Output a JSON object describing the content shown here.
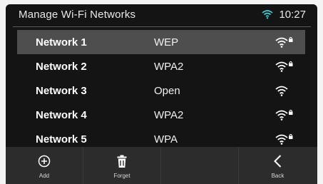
{
  "header": {
    "title": "Manage Wi-Fi Networks",
    "time": "10:27",
    "status_icon": "wifi-icon"
  },
  "networks": [
    {
      "name": "Network 1",
      "security": "WEP",
      "locked": true,
      "selected": true
    },
    {
      "name": "Network 2",
      "security": "WPA2",
      "locked": true,
      "selected": false
    },
    {
      "name": "Network 3",
      "security": "Open",
      "locked": false,
      "selected": false
    },
    {
      "name": "Network 4",
      "security": "WPA2",
      "locked": true,
      "selected": false
    },
    {
      "name": "Network 5",
      "security": "WPA",
      "locked": true,
      "selected": false
    }
  ],
  "toolbar": {
    "add_label": "Add",
    "forget_label": "Forget",
    "empty_label": "",
    "back_label": "Back"
  },
  "colors": {
    "background": "#141414",
    "selected_row": "#4e4e4e",
    "toolbar": "#2c2c2c",
    "text": "#ffffff"
  }
}
